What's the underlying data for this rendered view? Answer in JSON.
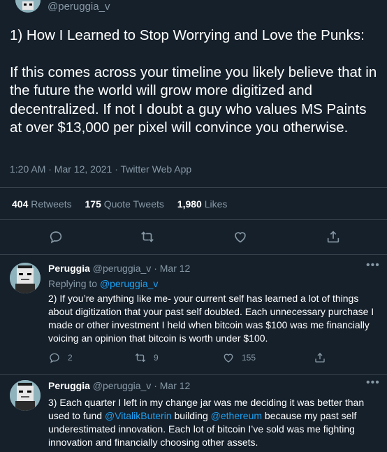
{
  "header": {
    "handle": "@peruggia_v"
  },
  "tweet": {
    "title": "1) How I Learned to Stop Worrying and Love the Punks:",
    "body": "If this comes across your timeline you likely believe that in the future the world will grow more digitized and decentralized. If not I doubt a guy who values MS Paints at over $13,000 per pixel will convince you otherwise.",
    "meta": "1:20 AM · Mar 12, 2021 · Twitter Web App",
    "stats": {
      "retweets_count": "404",
      "retweets_label": "Retweets",
      "quotes_count": "175",
      "quotes_label": "Quote Tweets",
      "likes_count": "1,980",
      "likes_label": "Likes"
    }
  },
  "replies": [
    {
      "name": "Peruggia",
      "handle": "@peruggia_v",
      "sep": "·",
      "date": "Mar 12",
      "replying_prefix": "Replying to",
      "replying_to": "@peruggia_v",
      "text": "2) If you’re anything like me- your current self has learned a lot of things about digitization that your past self doubted. Each unnecessary purchase I made or other investment I held when bitcoin was $100 was me financially voicing an opinion that bitcoin is worth under $100.",
      "reply_count": "2",
      "retweet_count": "9",
      "like_count": "155"
    },
    {
      "name": "Peruggia",
      "handle": "@peruggia_v",
      "sep": "·",
      "date": "Mar 12",
      "text_a": "3) Each quarter I left in my change jar was me deciding it was better than used to fund ",
      "mention1": "@VitalikButerin",
      "text_b": " building ",
      "mention2": "@ethereum",
      "text_c": " because my past self underestimated innovation. Each lot of bitcoin I’ve sold was me fighting innovation and financially choosing other assets."
    }
  ],
  "colors": {
    "background": "#15202b",
    "text": "#ffffff",
    "muted": "#8899a6",
    "link": "#1da1f2",
    "divider": "#38444d"
  }
}
